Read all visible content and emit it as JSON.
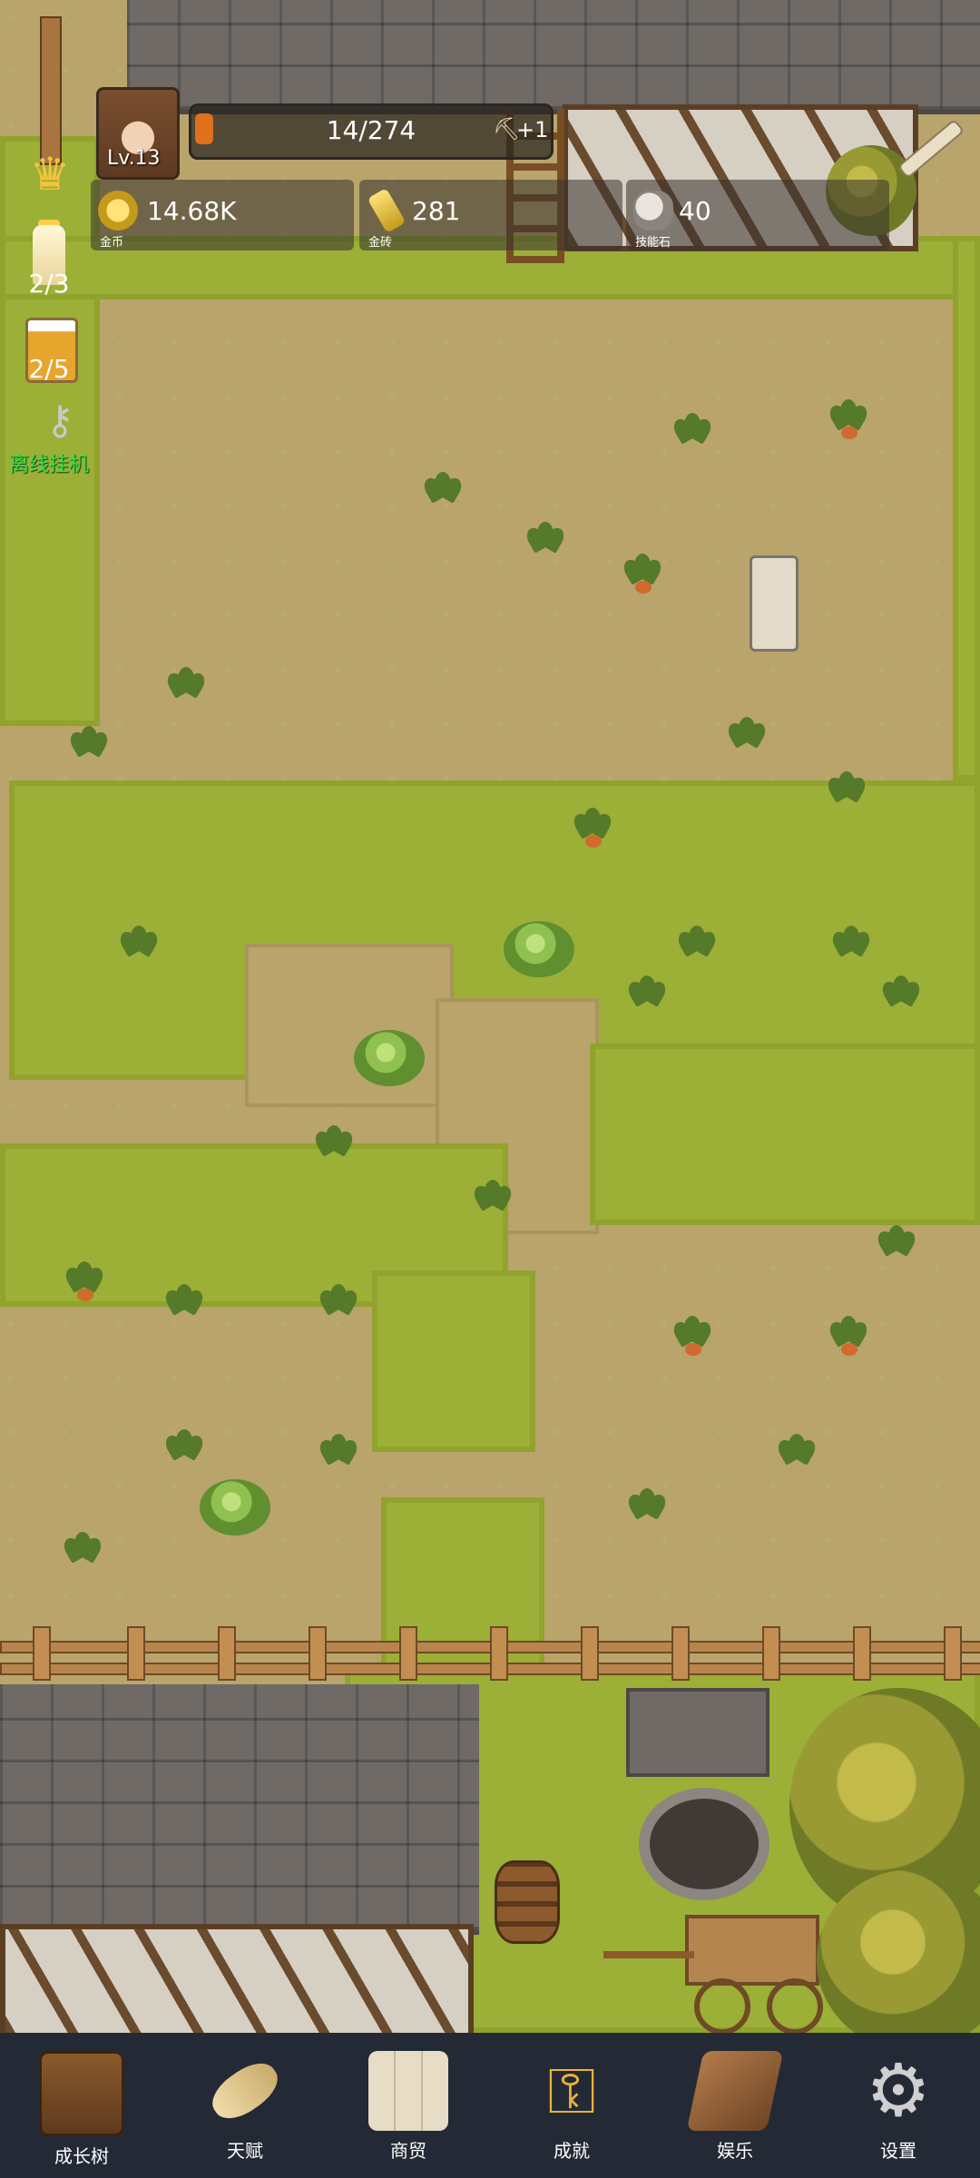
{
  "player": {
    "level": "Lv.13",
    "xp_text": "14/274",
    "xp_progress": 0.051,
    "pickaxe_bonus": "+1"
  },
  "resources": [
    {
      "value": "14.68K",
      "caption": "金币",
      "icon": "gold-coin-icon"
    },
    {
      "value": "281",
      "caption": "金砖",
      "icon": "gold-bar-icon"
    },
    {
      "value": "40",
      "caption": "技能石",
      "icon": "skill-stone-icon"
    }
  ],
  "side": {
    "candle_count": "2/3",
    "beer_count": "2/5",
    "idle_label": "离线挂机"
  },
  "tabs": [
    {
      "label": "成长树",
      "icon": "book-icon"
    },
    {
      "label": "天赋",
      "icon": "scroll-icon"
    },
    {
      "label": "商贸",
      "icon": "map-icon"
    },
    {
      "label": "成就",
      "icon": "key-icon"
    },
    {
      "label": "娱乐",
      "icon": "parchment-icon"
    },
    {
      "label": "设置",
      "icon": "gear-icon"
    }
  ],
  "colors": {
    "tab_bar": "#242a35",
    "grass": "#9caf36",
    "dirt": "#b9a46c",
    "xp_bar_fill": "#e0701c"
  }
}
